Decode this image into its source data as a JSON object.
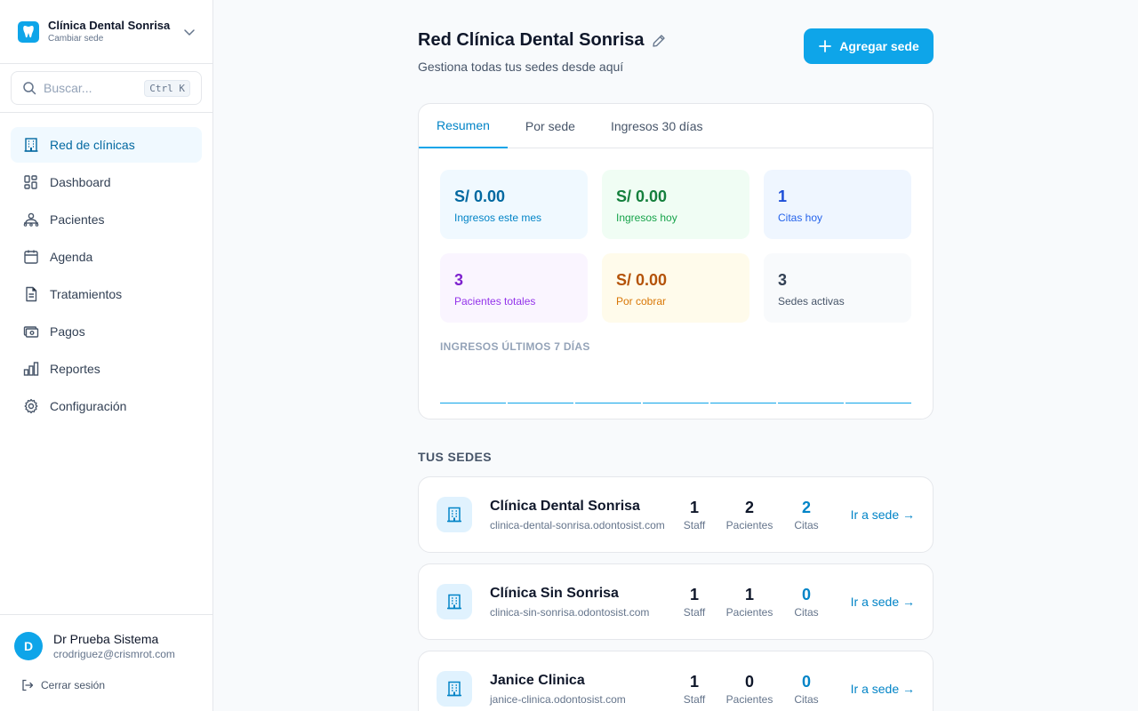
{
  "sidebar": {
    "brand_name": "Clínica Dental Sonrisa",
    "brand_sub": "Cambiar sede",
    "search_placeholder": "Buscar...",
    "search_shortcut": "Ctrl K",
    "items": [
      {
        "label": "Red de clínicas",
        "icon": "building-icon",
        "active": true
      },
      {
        "label": "Dashboard",
        "icon": "dashboard-icon"
      },
      {
        "label": "Pacientes",
        "icon": "patients-icon"
      },
      {
        "label": "Agenda",
        "icon": "calendar-icon"
      },
      {
        "label": "Tratamientos",
        "icon": "document-icon"
      },
      {
        "label": "Pagos",
        "icon": "money-icon"
      },
      {
        "label": "Reportes",
        "icon": "chart-icon"
      },
      {
        "label": "Configuración",
        "icon": "gear-icon"
      }
    ],
    "user": {
      "initial": "D",
      "name": "Dr Prueba Sistema",
      "email": "crodriguez@crismrot.com"
    },
    "logout_label": "Cerrar sesión"
  },
  "header": {
    "title": "Red Clínica Dental Sonrisa",
    "subtitle": "Gestiona todas tus sedes desde aquí",
    "add_button": "Agregar sede"
  },
  "summary": {
    "tabs": [
      "Resumen",
      "Por sede",
      "Ingresos 30 días"
    ],
    "active_tab": "Resumen",
    "stats": [
      {
        "value": "S/ 0.00",
        "label": "Ingresos este mes"
      },
      {
        "value": "S/ 0.00",
        "label": "Ingresos hoy"
      },
      {
        "value": "1",
        "label": "Citas hoy"
      },
      {
        "value": "3",
        "label": "Pacientes totales"
      },
      {
        "value": "S/ 0.00",
        "label": "Por cobrar"
      },
      {
        "value": "3",
        "label": "Sedes activas"
      }
    ],
    "chart_title": "INGRESOS ÚLTIMOS 7 DÍAS"
  },
  "chart_data": {
    "type": "bar",
    "values": [
      0,
      0,
      0,
      0,
      0,
      0,
      0
    ]
  },
  "sedes_title": "TUS SEDES",
  "sedes": [
    {
      "name": "Clínica Dental Sonrisa",
      "url": "clinica-dental-sonrisa.odontosist.com",
      "staff": "1",
      "pacientes": "2",
      "citas": "2"
    },
    {
      "name": "Clínica Sin Sonrisa",
      "url": "clinica-sin-sonrisa.odontosist.com",
      "staff": "1",
      "pacientes": "1",
      "citas": "0"
    },
    {
      "name": "Janice Clinica",
      "url": "janice-clinica.odontosist.com",
      "staff": "1",
      "pacientes": "0",
      "citas": "0"
    }
  ],
  "labels": {
    "staff": "Staff",
    "pacientes": "Pacientes",
    "citas": "Citas",
    "go": "Ir a sede →"
  },
  "colors": {
    "accent": "#0ea5e9",
    "accent_dark": "#0284c7"
  }
}
